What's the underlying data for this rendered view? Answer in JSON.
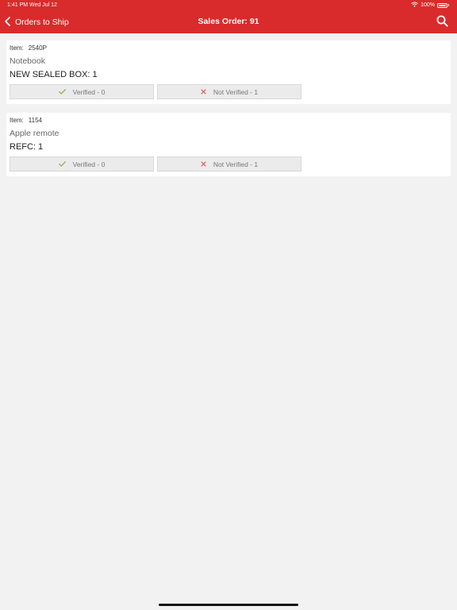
{
  "status_bar": {
    "time_date": "1:41 PM   Wed Jul 12",
    "battery": "100%"
  },
  "navbar": {
    "back_label": "Orders to Ship",
    "title": "Sales Order: 91"
  },
  "items": [
    {
      "code_label": "Item:",
      "code": "2540P",
      "name": "Notebook",
      "qty_text": "NEW SEALED BOX: 1",
      "verified_label": "Verified - 0",
      "not_verified_label": "Not Verified - 1"
    },
    {
      "code_label": "Item:",
      "code": "1154",
      "name": "Apple remote",
      "qty_text": "REFC: 1",
      "verified_label": "Verified - 0",
      "not_verified_label": "Not Verified - 1"
    }
  ],
  "colors": {
    "brand_red": "#d92b2b",
    "check_green": "#7cb342",
    "cross_red": "#d9534f"
  },
  "icons": {
    "back": "chevron-left-icon",
    "search": "search-icon",
    "verified": "checkmark-icon",
    "not_verified": "cross-icon",
    "wifi": "wifi-icon",
    "battery": "battery-icon"
  }
}
